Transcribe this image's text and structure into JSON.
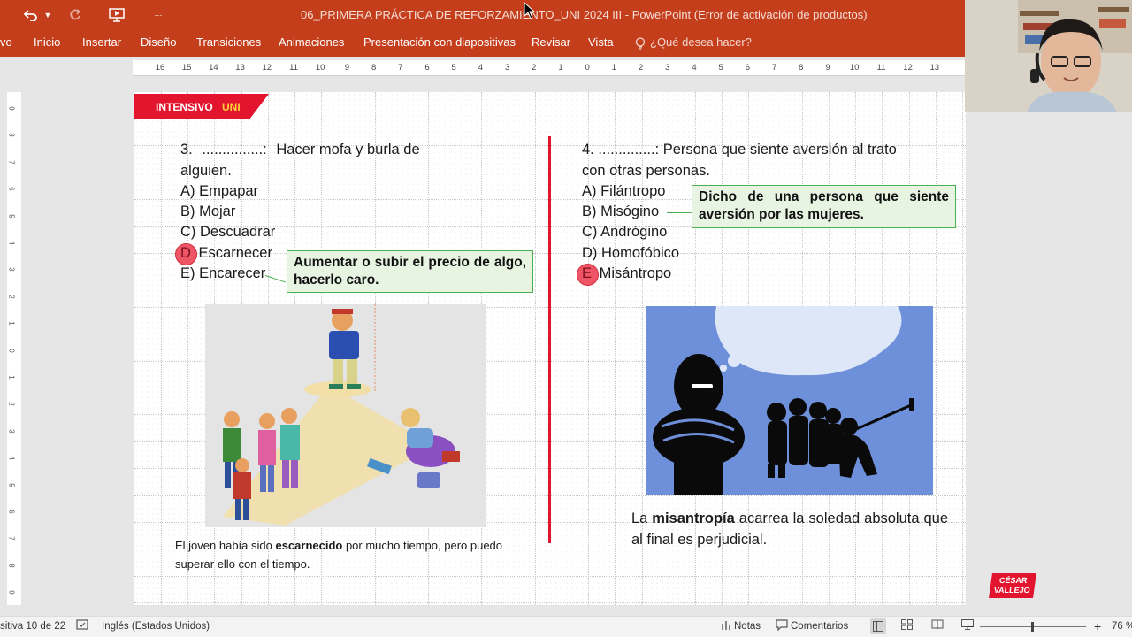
{
  "window": {
    "title": "06_PRIMERA PRÁCTICA DE REFORZAMIENTO_UNI 2024 III - PowerPoint (Error de activación de productos)"
  },
  "ribbon": {
    "tabs": [
      {
        "label": "vo"
      },
      {
        "label": "Inicio"
      },
      {
        "label": "Insertar"
      },
      {
        "label": "Diseño"
      },
      {
        "label": "Transiciones"
      },
      {
        "label": "Animaciones"
      },
      {
        "label": "Presentación con diapositivas"
      },
      {
        "label": "Revisar"
      },
      {
        "label": "Vista"
      }
    ],
    "tell_me": "¿Qué desea hacer?"
  },
  "ruler": {
    "labels": [
      "16",
      "15",
      "14",
      "13",
      "12",
      "11",
      "10",
      "9",
      "8",
      "7",
      "6",
      "5",
      "4",
      "3",
      "2",
      "1",
      "0",
      "1",
      "2",
      "3",
      "4",
      "5",
      "6",
      "7",
      "8",
      "9",
      "10",
      "11",
      "12",
      "13"
    ]
  },
  "vruler": {
    "labels": [
      "9",
      "8",
      "7",
      "6",
      "5",
      "4",
      "3",
      "2",
      "1",
      "0",
      "1",
      "2",
      "3",
      "4",
      "5",
      "6",
      "7",
      "8",
      "9"
    ]
  },
  "slide": {
    "badge": {
      "part1": "INTENSIVO",
      "part2": "UNI"
    },
    "q3": {
      "line1_num": "3.",
      "line1_blank": "...............:",
      "line1_text": "Hacer  mofa  y  burla  de",
      "line2": "alguien.",
      "options": [
        {
          "letter": "A)",
          "text": "Empapar"
        },
        {
          "letter": "B)",
          "text": "Mojar"
        },
        {
          "letter": "C)",
          "text": "Descuadrar"
        },
        {
          "letter": "D",
          "text": "Escarnecer"
        },
        {
          "letter": "E)",
          "text": "Encarecer"
        }
      ],
      "definition": "Aumentar o subir el precio de algo, hacerlo caro.",
      "caption_pre": "El joven había sido ",
      "caption_bold": "escarnecido",
      "caption_post": " por mucho tiempo, pero puedo superar ello con el tiempo."
    },
    "q4": {
      "line1": "4. ..............: Persona que siente aversión al trato",
      "line2": "con otras personas.",
      "options": [
        {
          "letter": "A)",
          "text": "Filántropo"
        },
        {
          "letter": "B)",
          "text": "Misógino"
        },
        {
          "letter": "C)",
          "text": "Andrógino"
        },
        {
          "letter": "D)",
          "text": "Homofóbico"
        },
        {
          "letter": "E",
          "text": "Misántropo"
        }
      ],
      "definition": "Dicho de una persona que siente aversión por las mujeres.",
      "caption_pre": "La ",
      "caption_bold": "misantropía",
      "caption_post": " acarrea la soledad absoluta que al final es perjudicial."
    },
    "logo": {
      "line1": "CÉSAR",
      "line2": "VALLEJO"
    }
  },
  "statusbar": {
    "slide_info": "sitiva 10 de 22",
    "language": "Inglés (Estados Unidos)",
    "notes": "Notas",
    "comments": "Comentarios",
    "zoom": "76 %"
  },
  "colors": {
    "ribbon": "#c43e1c",
    "badge_red": "#e3142d",
    "answer_circle": "#f05565",
    "def_border": "#4caf50",
    "def_fill": "#e8f4e2",
    "illus_blue": "#6e8fd9"
  }
}
